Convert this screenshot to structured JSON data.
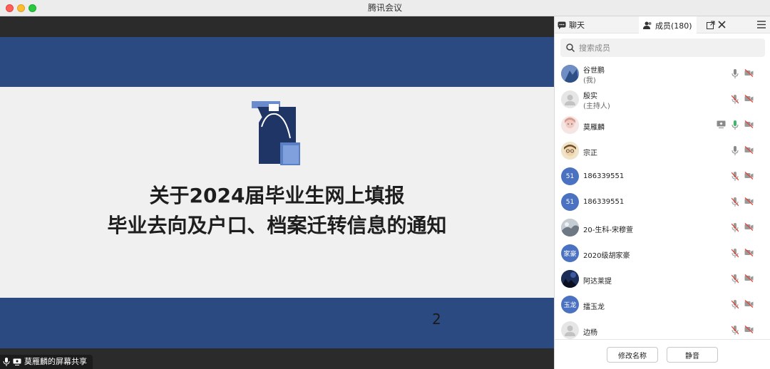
{
  "window": {
    "title": "腾讯会议"
  },
  "slide": {
    "title_line1": "关于2024届毕业生网上填报",
    "title_line2": "毕业去向及户口、档案迁转信息的通知",
    "page_number": "2",
    "band_color": "#2c4a82"
  },
  "share_indicator": {
    "label": "莫雁麟的屏幕共享"
  },
  "panel": {
    "tabs": [
      {
        "label": "聊天",
        "icon": "chat-icon"
      },
      {
        "label": "成员(180)",
        "icon": "members-icon"
      }
    ],
    "search": {
      "placeholder": "搜索成员",
      "value": ""
    },
    "members": [
      {
        "name": "谷世鹏",
        "role": "(我)",
        "avatar": "photo",
        "mic": "on",
        "camera": "off",
        "sharing": false
      },
      {
        "name": "殷实",
        "role": "(主持人)",
        "avatar": "default",
        "mic": "muted",
        "camera": "off",
        "sharing": false
      },
      {
        "name": "莫雁麟",
        "role": "",
        "avatar": "photo",
        "mic": "active",
        "camera": "off",
        "sharing": true
      },
      {
        "name": "宗正",
        "role": "",
        "avatar": "photo",
        "mic": "on",
        "camera": "off",
        "sharing": false
      },
      {
        "name": "186339551",
        "role": "",
        "avatar": "51",
        "mic": "muted",
        "camera": "off",
        "sharing": false
      },
      {
        "name": "186339551",
        "role": "",
        "avatar": "51",
        "mic": "muted",
        "camera": "off",
        "sharing": false
      },
      {
        "name": "20-生科-宋穆萱",
        "role": "",
        "avatar": "photo",
        "mic": "muted",
        "camera": "off",
        "sharing": false
      },
      {
        "name": "2020级胡家豪",
        "role": "",
        "avatar": "家豪",
        "mic": "muted",
        "camera": "off",
        "sharing": false
      },
      {
        "name": "阿达莱提",
        "role": "",
        "avatar": "photo",
        "mic": "muted",
        "camera": "off",
        "sharing": false
      },
      {
        "name": "擂玉龙",
        "role": "",
        "avatar": "玉龙",
        "mic": "muted",
        "camera": "off",
        "sharing": false
      },
      {
        "name": "边杨",
        "role": "",
        "avatar": "default",
        "mic": "muted",
        "camera": "off",
        "sharing": false
      }
    ],
    "footer": {
      "rename_label": "修改名称",
      "mute_label": "静音"
    }
  }
}
